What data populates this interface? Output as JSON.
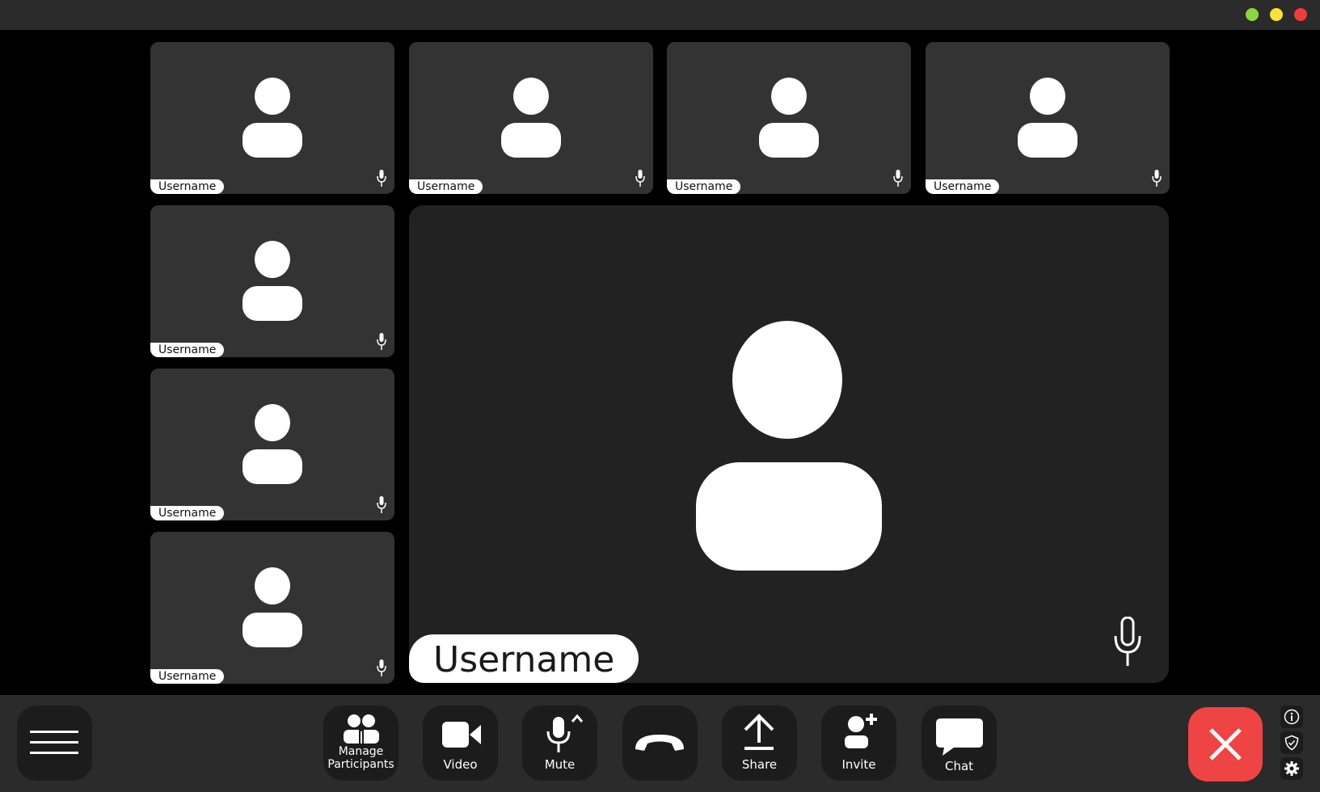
{
  "window": {
    "controls": [
      {
        "name": "maximize-button",
        "color": "#8fd63c"
      },
      {
        "name": "minimize-button",
        "color": "#f5e23a"
      },
      {
        "name": "close-window-button",
        "color": "#ee3c3c"
      }
    ]
  },
  "participants": [
    {
      "name": "Username"
    },
    {
      "name": "Username"
    },
    {
      "name": "Username"
    },
    {
      "name": "Username"
    },
    {
      "name": "Username"
    },
    {
      "name": "Username"
    },
    {
      "name": "Username"
    }
  ],
  "speaker": {
    "name": "Username"
  },
  "toolbar": {
    "manage_label_line1": "Manage",
    "manage_label_line2": "Participants",
    "video_label": "Video",
    "mute_label": "Mute",
    "share_label": "Share",
    "invite_label": "Invite",
    "chat_label": "Chat"
  },
  "icons": {
    "menu": "hamburger-icon",
    "participants": "people-icon",
    "video": "video-camera-icon",
    "mute": "microphone-icon",
    "end_call": "phone-hangup-icon",
    "share": "upload-arrow-icon",
    "invite": "add-person-icon",
    "chat": "speech-bubble-icon",
    "leave": "x-icon",
    "info": "info-icon",
    "security": "shield-icon",
    "settings": "gear-icon"
  },
  "colors": {
    "background": "#000000",
    "tile": "#333333",
    "speaker_tile": "#222222",
    "toolbar": "#2b2b2b",
    "leave_button": "#ef4444"
  }
}
